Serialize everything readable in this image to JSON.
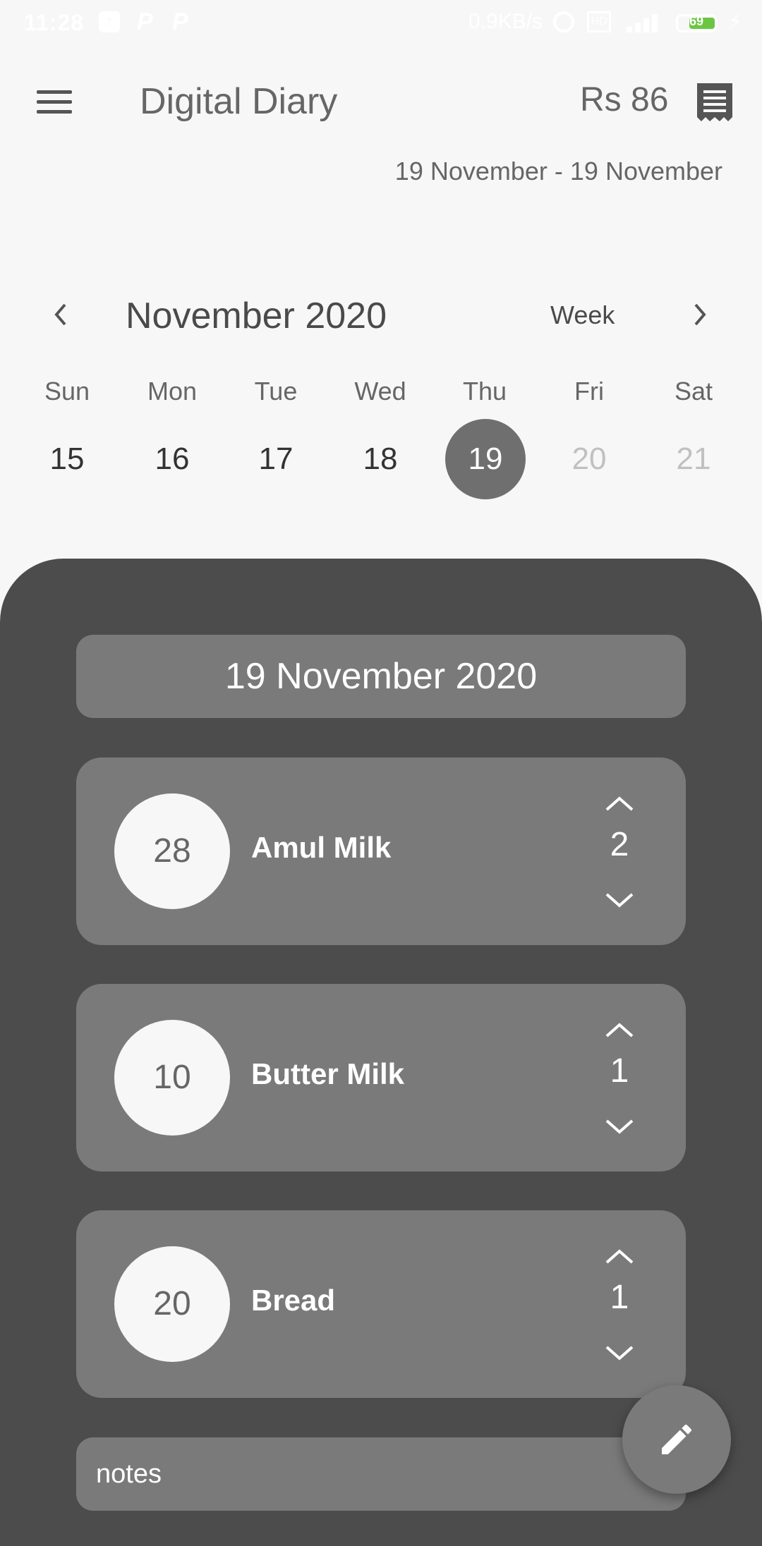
{
  "status_bar": {
    "time": "11:28",
    "net_speed": "0.9KB/s",
    "battery": "69"
  },
  "app_bar": {
    "title": "Digital Diary",
    "total": "Rs 86"
  },
  "date_range": "19 November - 19 November",
  "calendar": {
    "month": "November 2020",
    "view": "Week",
    "weekdays": [
      "Sun",
      "Mon",
      "Tue",
      "Wed",
      "Thu",
      "Fri",
      "Sat"
    ],
    "days": [
      "15",
      "16",
      "17",
      "18",
      "19",
      "20",
      "21"
    ],
    "selected_day": "19"
  },
  "selected_date": "19 November 2020",
  "items": [
    {
      "price": "28",
      "name": "Amul Milk",
      "qty": "2"
    },
    {
      "price": "10",
      "name": "Butter Milk",
      "qty": "1"
    },
    {
      "price": "20",
      "name": "Bread",
      "qty": "1"
    }
  ],
  "notes": {
    "placeholder": "notes"
  },
  "colors": {
    "background": "#f7f7f7",
    "sheet": "#4c4c4c",
    "card": "#7a7a7a",
    "selected_day": "#6f6f6f",
    "battery_fill": "#6cc644"
  }
}
